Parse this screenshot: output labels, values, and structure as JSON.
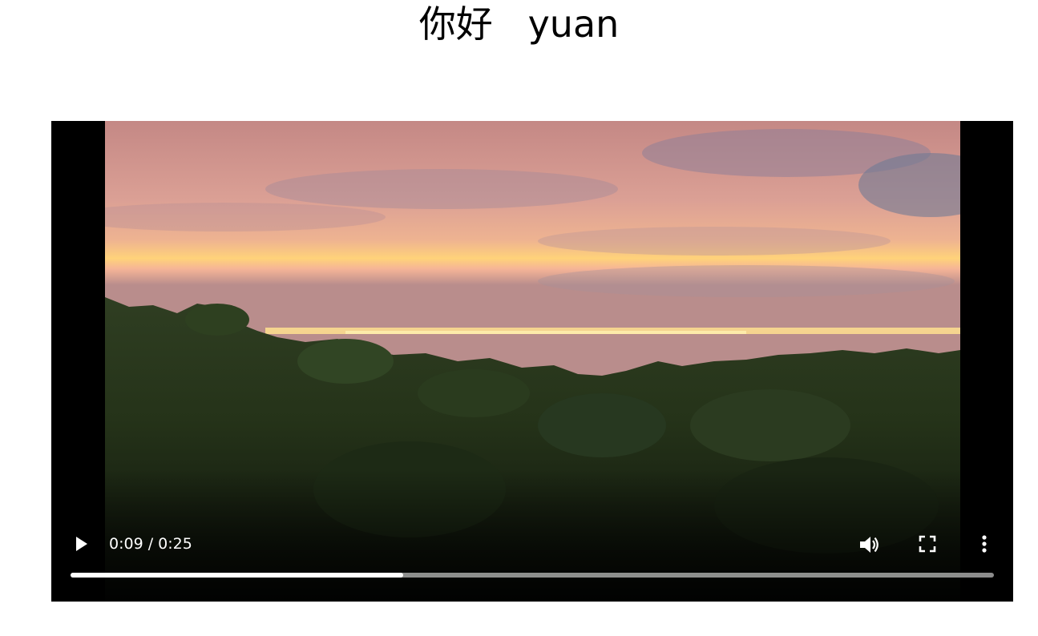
{
  "page": {
    "title": "你好   yuan"
  },
  "player": {
    "current_time": "0:09",
    "duration": "0:25",
    "time_display": "0:09 / 0:25",
    "progress_fraction": 0.36,
    "icons": {
      "play": "play-icon",
      "volume": "volume-icon",
      "fullscreen": "fullscreen-icon",
      "more": "more-options-icon"
    },
    "colors": {
      "progress_played": "#ffffff",
      "progress_track": "#bfbfbf",
      "controls_text": "#ffffff"
    }
  }
}
